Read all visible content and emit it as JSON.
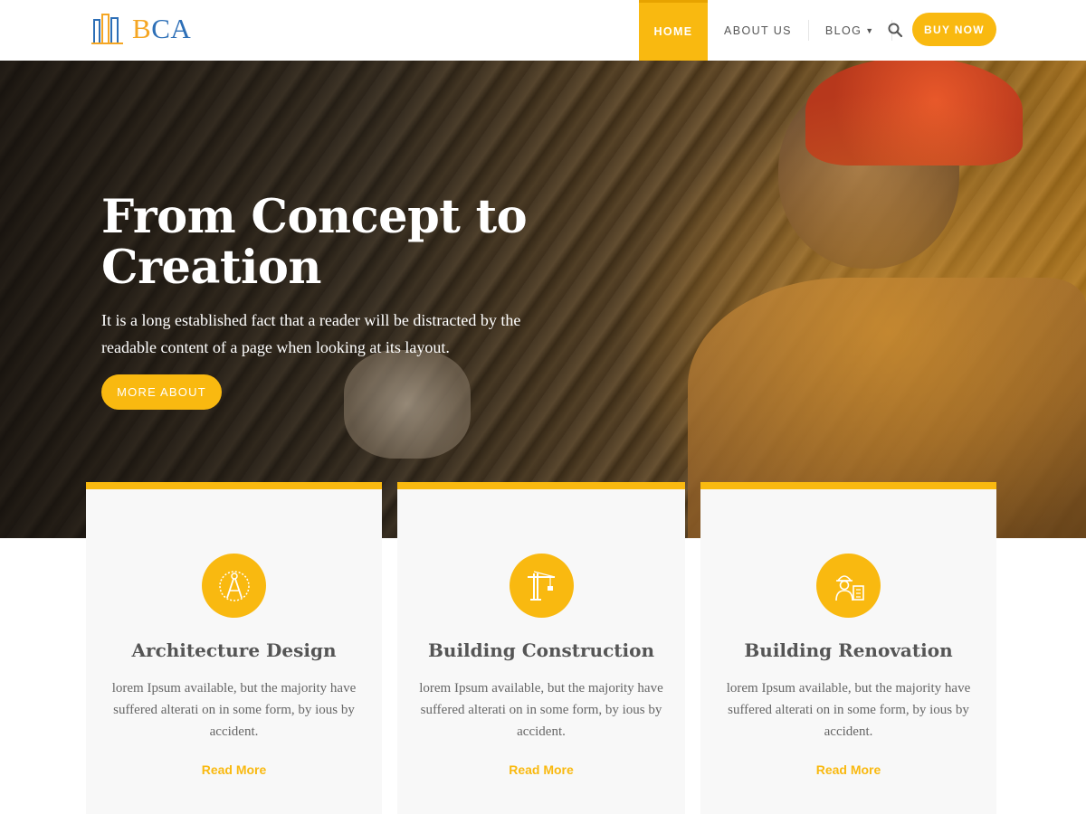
{
  "brand": {
    "name_part1": "B",
    "name_part2": "CA",
    "accent": "#f9b910",
    "logo_icon": "building-logo-icon"
  },
  "nav": {
    "items": [
      {
        "label": "HOME",
        "active": true
      },
      {
        "label": "ABOUT US",
        "active": false
      },
      {
        "label": "BLOG",
        "active": false,
        "dropdown": true
      }
    ],
    "search_icon": "search-icon",
    "buy_label": "BUY NOW"
  },
  "hero": {
    "title": "From Concept to Creation",
    "text": "It is a long established fact that a reader will be distracted by the readable content of a page when looking at its layout.",
    "button_label": "MORE ABOUT"
  },
  "services": [
    {
      "icon": "compass-icon",
      "title": "Architecture Design",
      "text": "lorem Ipsum available, but the majority have suffered alterati on in some form, by ious by accident.",
      "link": "Read More"
    },
    {
      "icon": "crane-icon",
      "title": "Building Construction",
      "text": "lorem Ipsum available, but the majority have suffered alterati on in some form, by ious by accident.",
      "link": "Read More"
    },
    {
      "icon": "worker-icon",
      "title": "Building Renovation",
      "text": "lorem Ipsum available, but the majority have suffered alterati on in some form, by ious by accident.",
      "link": "Read More"
    }
  ]
}
